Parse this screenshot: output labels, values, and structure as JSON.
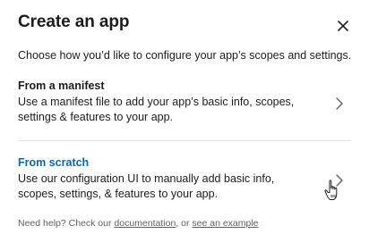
{
  "dialog": {
    "title": "Create an app",
    "close_icon": "close-icon",
    "intro": "Choose how you’d like to configure your app’s scopes and settings."
  },
  "options": [
    {
      "title": "From a manifest",
      "description": "Use a manifest file to add your app’s basic info, scopes, settings & features to your app.",
      "icon": "chevron-right-icon"
    },
    {
      "title": "From scratch",
      "description": "Use our configuration UI to manually add basic info, scopes, settings, & features to your app.",
      "icon": "chevron-right-icon",
      "hovered": true
    }
  ],
  "help": {
    "prefix": "Need help? Check our ",
    "link1": "documentation",
    "middle": ", or ",
    "link2": "see an example"
  },
  "colors": {
    "text": "#1d1c1d",
    "link_hover": "#1264a3",
    "muted": "#616061",
    "divider": "#e2e2e2"
  },
  "cursor": "hand-pointer-cursor"
}
